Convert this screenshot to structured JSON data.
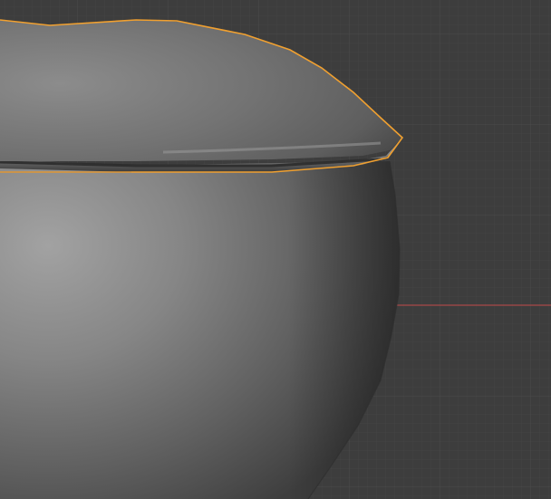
{
  "viewport": {
    "background_color": "#3d3d3d",
    "grid_minor_color": "#434343",
    "grid_major_color": "#4a4a4a",
    "x_axis_color": "#a84848",
    "selection_outline_color": "#f0a030",
    "mesh_light_color": "#a8a8a8",
    "mesh_mid_color": "#6a6a6a",
    "mesh_dark_color": "#3a3a3a"
  },
  "scene": {
    "objects": [
      {
        "name": "lid",
        "selected": true
      },
      {
        "name": "bowl",
        "selected": false
      }
    ]
  }
}
